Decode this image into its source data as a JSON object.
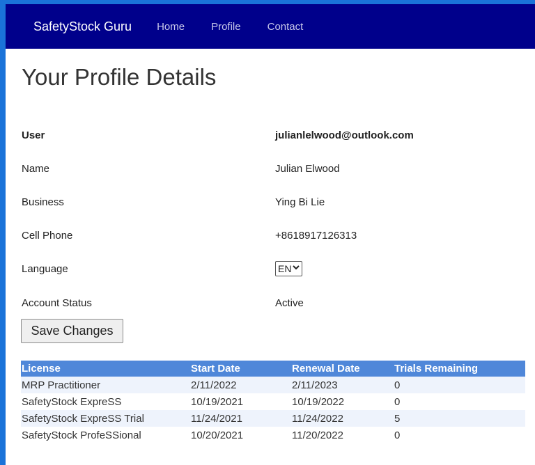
{
  "nav": {
    "brand": "SafetyStock Guru",
    "links": [
      "Home",
      "Profile",
      "Contact"
    ]
  },
  "page": {
    "title": "Your Profile Details"
  },
  "profile": {
    "user_label": "User",
    "user_value": "julianlelwood@outlook.com",
    "name_label": "Name",
    "name_value": "Julian Elwood",
    "business_label": "Business",
    "business_value": "Ying Bi Lie",
    "phone_label": "Cell Phone",
    "phone_value": "+8618917126313",
    "language_label": "Language",
    "language_value": "EN",
    "status_label": "Account Status",
    "status_value": "Active"
  },
  "actions": {
    "save_label": "Save Changes"
  },
  "licenses": {
    "headers": [
      "License",
      "Start Date",
      "Renewal Date",
      "Trials Remaining"
    ],
    "rows": [
      [
        "MRP Practitioner",
        "2/11/2022",
        "2/11/2023",
        "0"
      ],
      [
        "SafetyStock ExpreSS",
        "10/19/2021",
        "10/19/2022",
        "0"
      ],
      [
        "SafetyStock ExpreSS Trial",
        "11/24/2021",
        "11/24/2022",
        "5"
      ],
      [
        "SafetyStock ProfeSSional",
        "10/20/2021",
        "11/20/2022",
        "0"
      ]
    ]
  },
  "colors": {
    "navbar": "#00008b",
    "window_border": "#1a73d9",
    "table_header": "#4f87d9",
    "alt_row": "#eef3fc"
  }
}
